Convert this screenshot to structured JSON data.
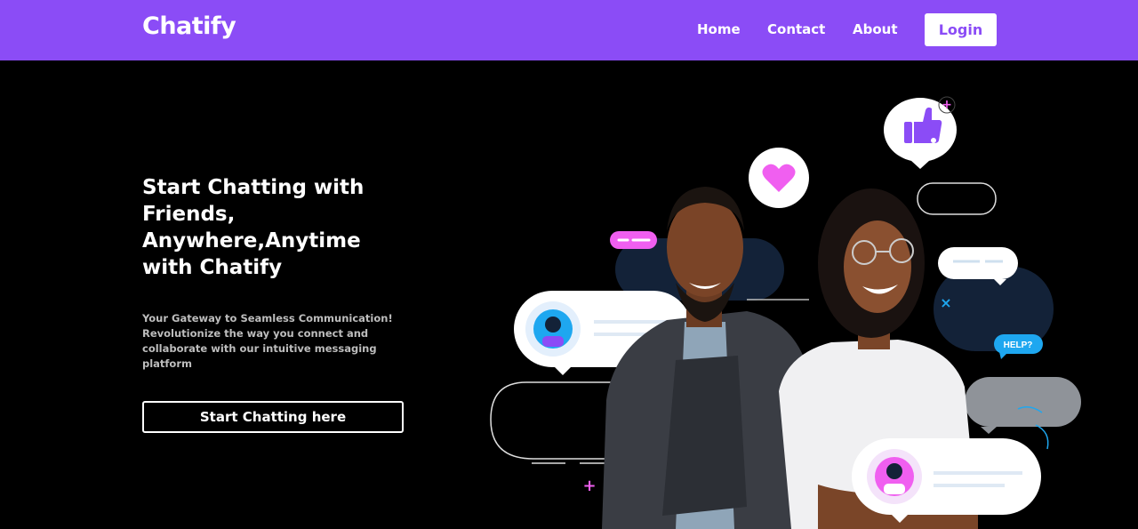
{
  "header": {
    "brand": "Chatify",
    "nav": {
      "home": "Home",
      "contact": "Contact",
      "about": "About"
    },
    "login_label": "Login"
  },
  "hero": {
    "title_lines": [
      "Start Chatting with",
      "Friends,",
      "Anywhere,Anytime",
      "with Chatify"
    ],
    "subtitle_lines": [
      "Your Gateway to Seamless Communication!",
      "Revolutionize the way you connect and",
      "collaborate with our intuitive messaging",
      "platform"
    ],
    "cta_label": "Start Chatting here"
  },
  "illustration": {
    "help_badge": "HELP?",
    "colors": {
      "purple": "#8b4cf6",
      "pink": "#f05ff0",
      "blue": "#1ea7f0",
      "navy": "#132238"
    },
    "icons": [
      "thumbs-up-icon",
      "heart-icon",
      "avatar-woman-icon",
      "avatar-man-icon",
      "plus-icon",
      "close-icon"
    ]
  }
}
